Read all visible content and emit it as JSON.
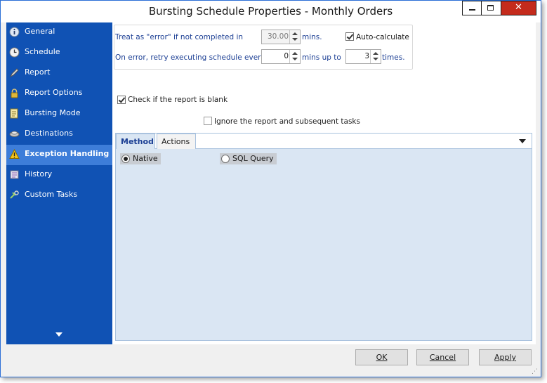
{
  "window": {
    "title": "Bursting Schedule Properties - Monthly Orders"
  },
  "sidebar": {
    "items": [
      {
        "label": "General",
        "icon": "info-icon"
      },
      {
        "label": "Schedule",
        "icon": "clock-icon"
      },
      {
        "label": "Report",
        "icon": "pen-icon"
      },
      {
        "label": "Report Options",
        "icon": "lock-icon"
      },
      {
        "label": "Bursting Mode",
        "icon": "bursting-icon"
      },
      {
        "label": "Destinations",
        "icon": "destinations-icon"
      },
      {
        "label": "Exception Handling",
        "icon": "warning-icon"
      },
      {
        "label": "History",
        "icon": "history-icon"
      },
      {
        "label": "Custom Tasks",
        "icon": "custom-tasks-icon"
      }
    ],
    "active": "Exception Handling"
  },
  "exception": {
    "timeout_label": "Treat as \"error\" if not completed in",
    "timeout_value": "30.00",
    "timeout_unit": "mins.",
    "auto_calculate_label": "Auto-calculate",
    "auto_calculate_checked": true,
    "retry_label": "On error, retry  executing schedule every",
    "retry_value": "0",
    "retry_unit": "mins up to",
    "retry_times_value": "3",
    "retry_times_unit": "times.",
    "blank_check_label": "Check if the report is blank",
    "blank_check_checked": true,
    "ignore_label": "Ignore the report and subsequent tasks",
    "ignore_checked": false
  },
  "tabs": {
    "items": [
      "Method",
      "Actions"
    ],
    "active": "Method",
    "method_native": "Native",
    "method_sql": "SQL Query",
    "selected_method": "Native"
  },
  "footer": {
    "ok": "OK",
    "cancel": "Cancel",
    "apply": "Apply"
  },
  "colors": {
    "sidebar": "#1052b4",
    "sidebar_active": "#3d7dd9",
    "label_blue": "#1c3f94",
    "close_red": "#c42b1c"
  }
}
